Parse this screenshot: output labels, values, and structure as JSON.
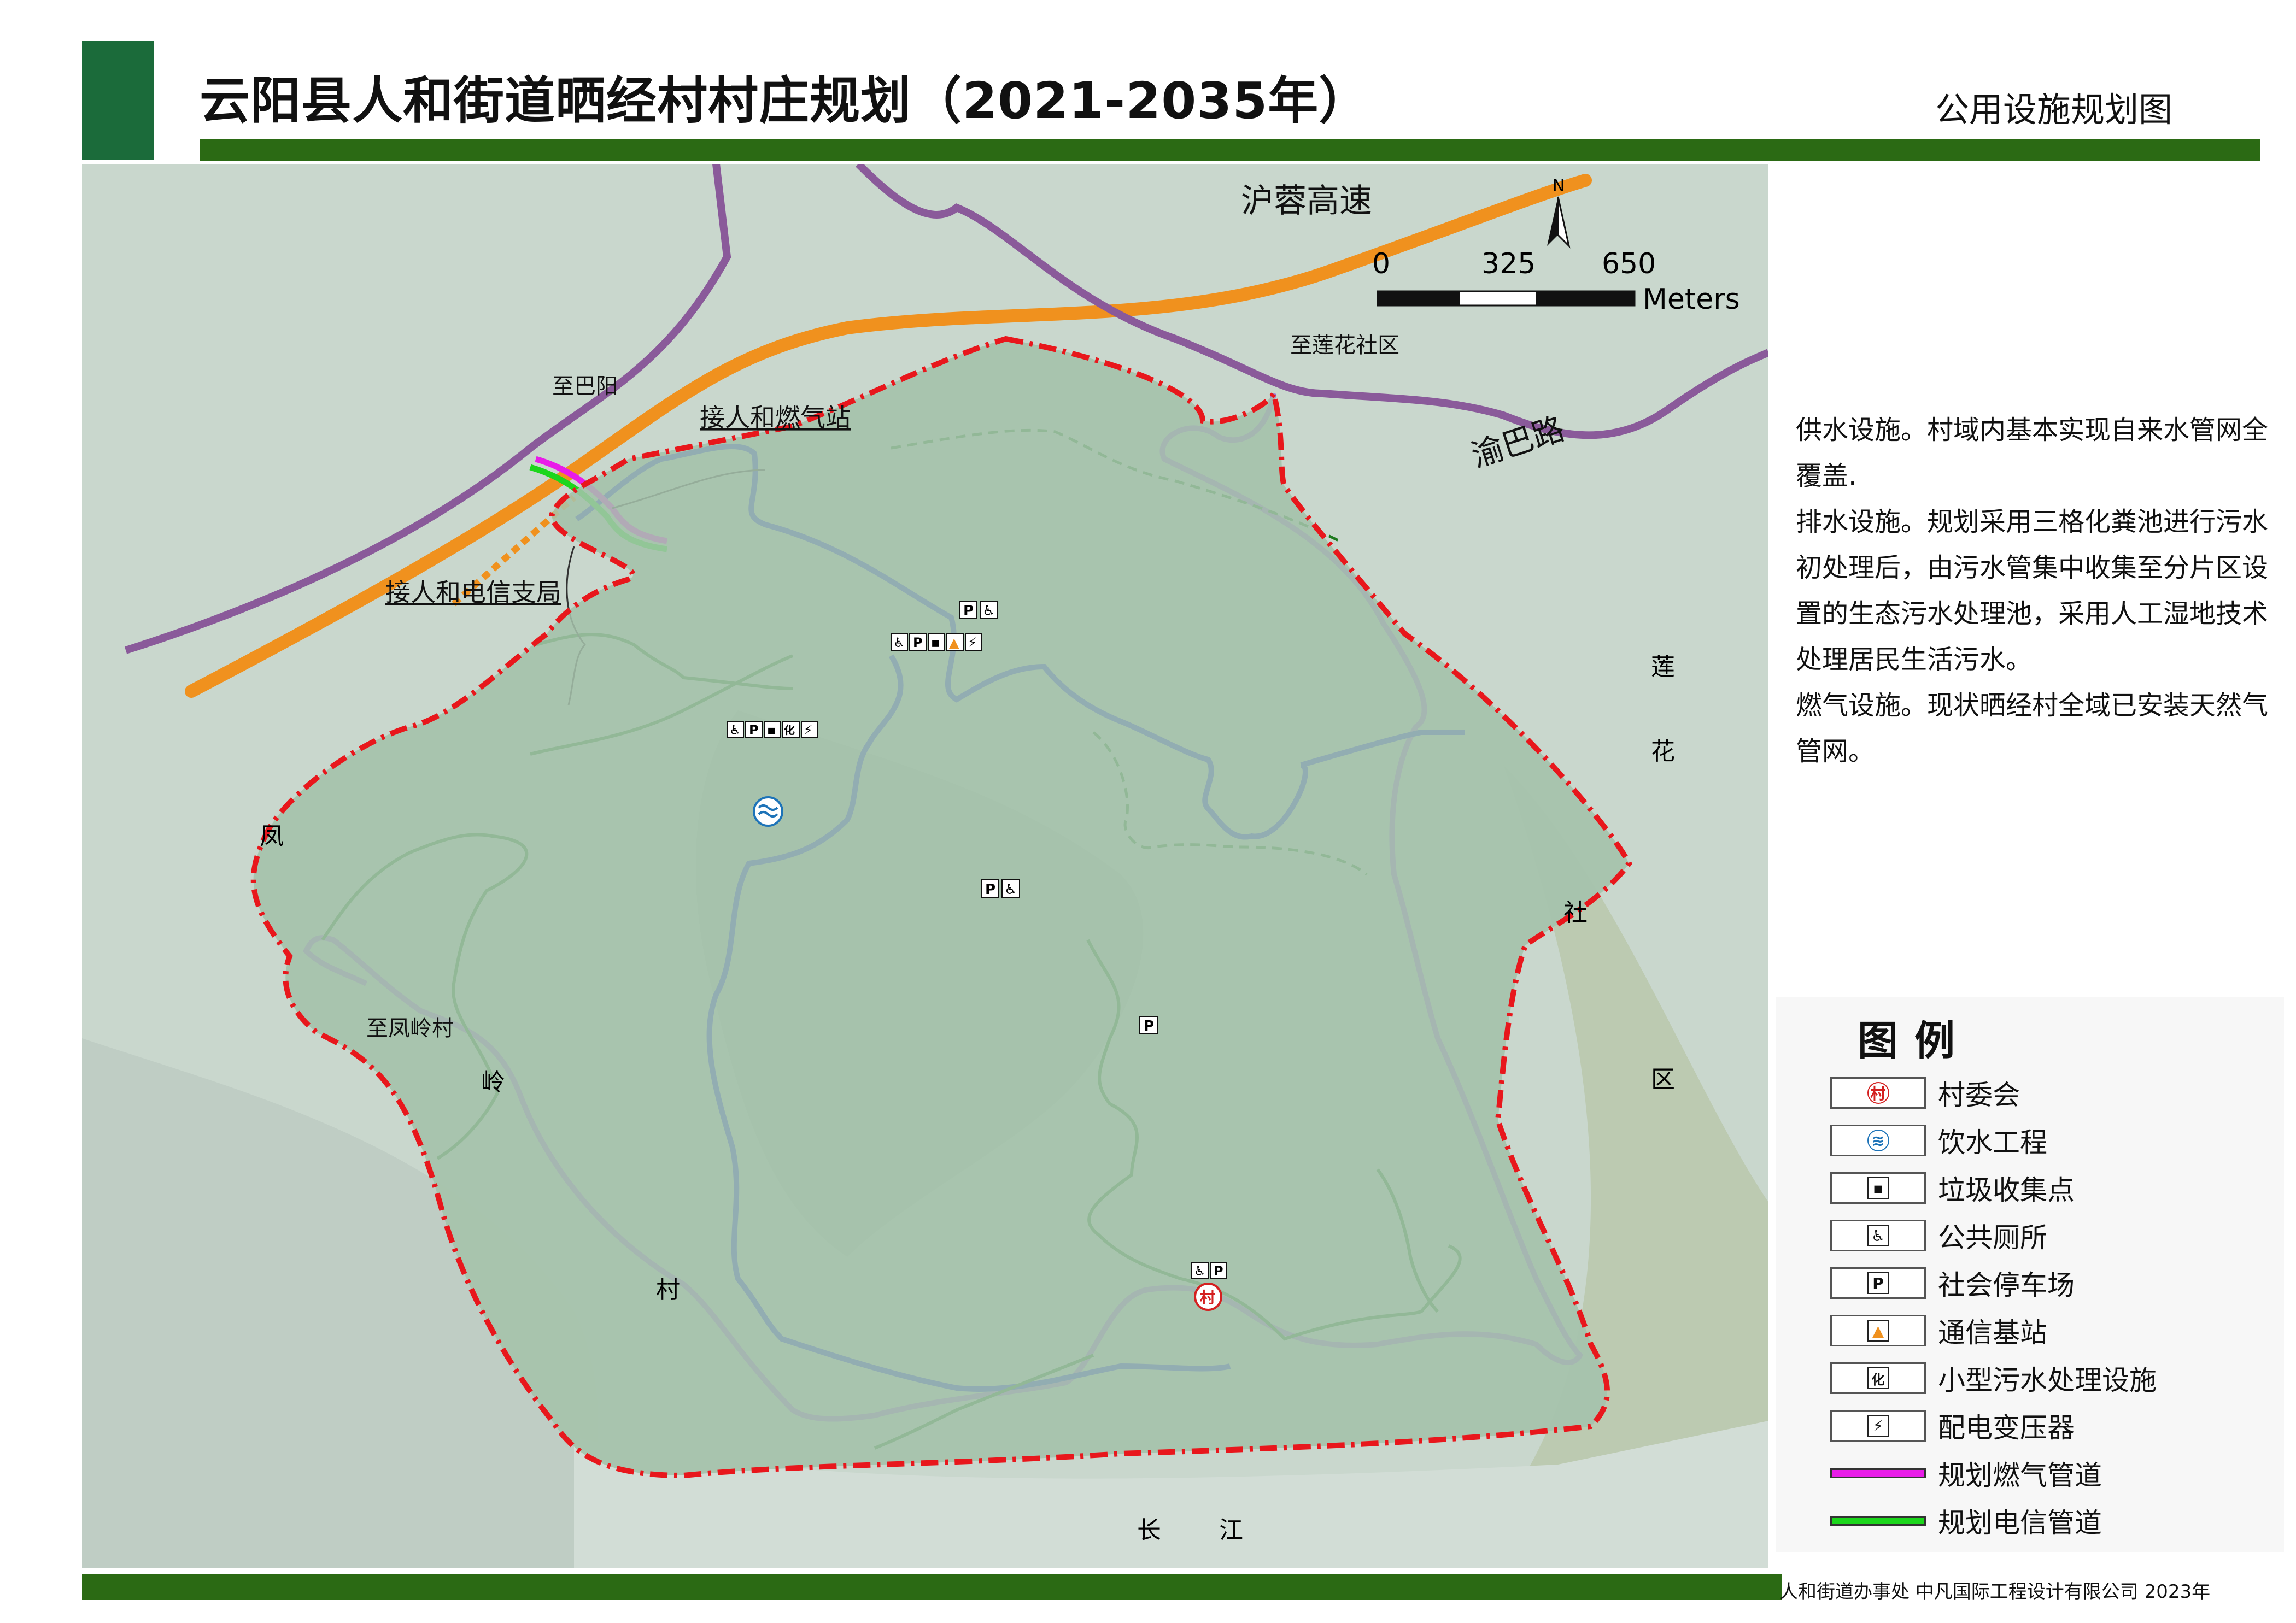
{
  "header": {
    "title": "云阳县人和街道晒经村村庄规划（2021-2035年）",
    "sheet_name": "公用设施规划图"
  },
  "colors": {
    "brand_green": "#1b6b3a",
    "bar_green": "#2b6a14",
    "highway_orange": "#f0911e",
    "road_purple": "#8a5a9a",
    "village_road_purple": "#9b6fc9",
    "main_road_blue": "#1f2fd0",
    "boundary_red": "#e8171c",
    "gas_pipe_magenta": "#e81ce8",
    "telecom_pipe_green": "#1cd61c",
    "path_green": "#1f7a1f"
  },
  "map": {
    "north_label": "N",
    "scale_ticks": [
      "0",
      "325",
      "650"
    ],
    "scale_unit": "Meters",
    "road_labels": {
      "highway": "沪蓉高速",
      "yuba_road": "渝巴路"
    },
    "place_labels": {
      "to_bayang": "至巴阳",
      "to_lianhua": "至莲花社区",
      "to_fengling": "至凤岭村",
      "gas_station": "接人和燃气站",
      "telecom_branch": "接人和电信支局"
    },
    "neighbors": {
      "lianhua": [
        "莲",
        "花",
        "社",
        "区"
      ],
      "fengling": [
        "凤",
        "岭",
        "村"
      ],
      "yangtze": [
        "长",
        "江"
      ]
    },
    "facility_icons": {
      "village_committee": "村",
      "parking": "P",
      "toilet": "♿",
      "sewage": "化",
      "transformer": "⚡",
      "trash": "▪",
      "tower": "▲"
    }
  },
  "notes": [
    "供水设施。村域内基本实现自来水管网全覆盖.",
    "排水设施。规划采用三格化粪池进行污水初处理后，由污水管集中收集至分片区设置的生态污水处理池，采用人工湿地技术处理居民生活污水。",
    "燃气设施。现状晒经村全域已安装天然气管网。"
  ],
  "legend": {
    "title": "图例",
    "items": [
      {
        "label": "村委会",
        "icon": "village-committee-icon",
        "glyph": "村"
      },
      {
        "label": "饮水工程",
        "icon": "water-icon",
        "glyph": "≋"
      },
      {
        "label": "垃圾收集点",
        "icon": "trash-icon",
        "glyph": "▪"
      },
      {
        "label": "公共厕所",
        "icon": "toilet-icon",
        "glyph": "♿"
      },
      {
        "label": "社会停车场",
        "icon": "parking-icon",
        "glyph": "P"
      },
      {
        "label": "通信基站",
        "icon": "tower-icon",
        "glyph": "▲"
      },
      {
        "label": "小型污水处理设施",
        "icon": "sewage-icon",
        "glyph": "化"
      },
      {
        "label": "配电变压器",
        "icon": "transformer-icon",
        "glyph": "⚡"
      },
      {
        "label": "规划燃气管道",
        "icon": "gas-pipe-icon",
        "glyph": ""
      },
      {
        "label": "规划电信管道",
        "icon": "telecom-pipe-icon",
        "glyph": ""
      }
    ]
  },
  "footer": {
    "credits": "人和街道办事处  中凡国际工程设计有限公司  2023年"
  }
}
